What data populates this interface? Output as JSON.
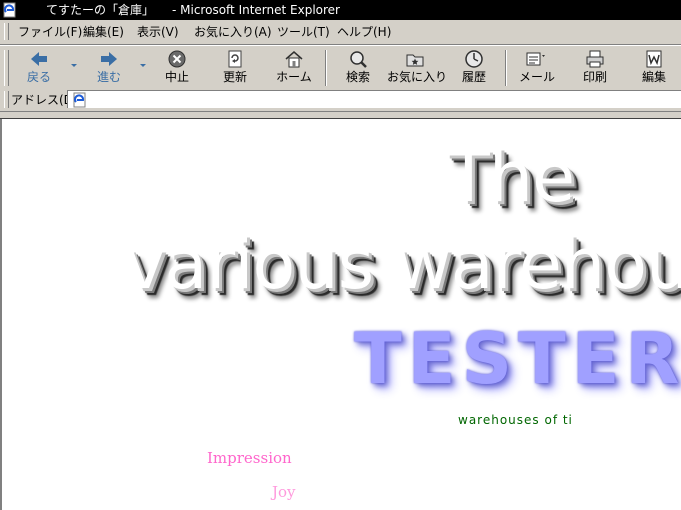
{
  "window": {
    "title": "てすたーの「倉庫」　　- Microsoft Internet Explorer",
    "icon": "ie-page-icon"
  },
  "menu": {
    "items": [
      "ファイル(F)",
      "編集(E)",
      "表示(V)",
      "お気に入り(A)",
      "ツール(T)",
      "ヘルプ(H)"
    ]
  },
  "toolbar": {
    "back": "戻る",
    "forward": "進む",
    "stop": "中止",
    "refresh": "更新",
    "home": "ホーム",
    "search": "検索",
    "favorites": "お気に入り",
    "history": "履歴",
    "mail": "メール",
    "print": "印刷",
    "edit": "編集"
  },
  "address": {
    "label": "アドレス(D)",
    "value": ""
  },
  "content": {
    "line1": "The",
    "line2": "various warehous",
    "line3": "TESTER",
    "subtitle": "warehouses of ti",
    "link1": "Impression",
    "link2": "Joy"
  },
  "colors": {
    "tester": "#a0a0ff",
    "subtitle": "#006600",
    "link1": "#ff66cc",
    "link2": "#ff99dd",
    "chrome": "#d4d0c8",
    "disabled_label": "#3a6ea5"
  }
}
